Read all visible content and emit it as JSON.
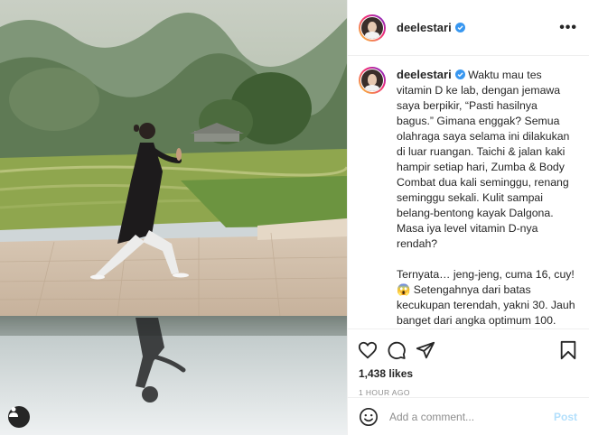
{
  "post": {
    "username": "deelestari",
    "verified": true,
    "more_icon": "more-options-icon",
    "caption": {
      "paragraph_1": "Waktu mau tes vitamin D ke lab, dengan jemawa saya berpikir, “Pasti hasilnya bagus.” Gimana enggak? Semua olahraga saya selama ini dilakukan di luar ruangan. Taichi & jalan kaki hampir setiap hari, Zumba & Body Combat dua kali seminggu, renang seminggu sekali. Kulit sampai belang-bentong kayak Dalgona. Masa iya level vitamin D-nya rendah?",
      "paragraph_2": "Ternyata… jeng-jeng, cuma 16, cuy! 😱 Setengahnya dari batas kecukupan terendah, yakni 30. Jauh banget dari angka optimum 100. Angka saya belum sampai defisien, tapi sudah insufisien. Alias, kagak cukup, boss. Akhirnya, beberapa hari ini saya mulai suplementasi."
    },
    "likes": "1,438 likes",
    "time_ago": "1 HOUR AGO",
    "comment": {
      "placeholder": "Add a comment...",
      "value": "",
      "post_label": "Post"
    },
    "icons": {
      "like": "heart-icon",
      "comment": "comment-icon",
      "share": "share-icon",
      "save": "bookmark-icon",
      "emoji": "emoji-icon",
      "user_tag": "user-tag-icon",
      "verified": "verified-badge-icon"
    },
    "colors": {
      "verified_blue": "#3897f0",
      "post_button_disabled": "#b2dffc",
      "muted_text": "#8e8e8e"
    }
  }
}
